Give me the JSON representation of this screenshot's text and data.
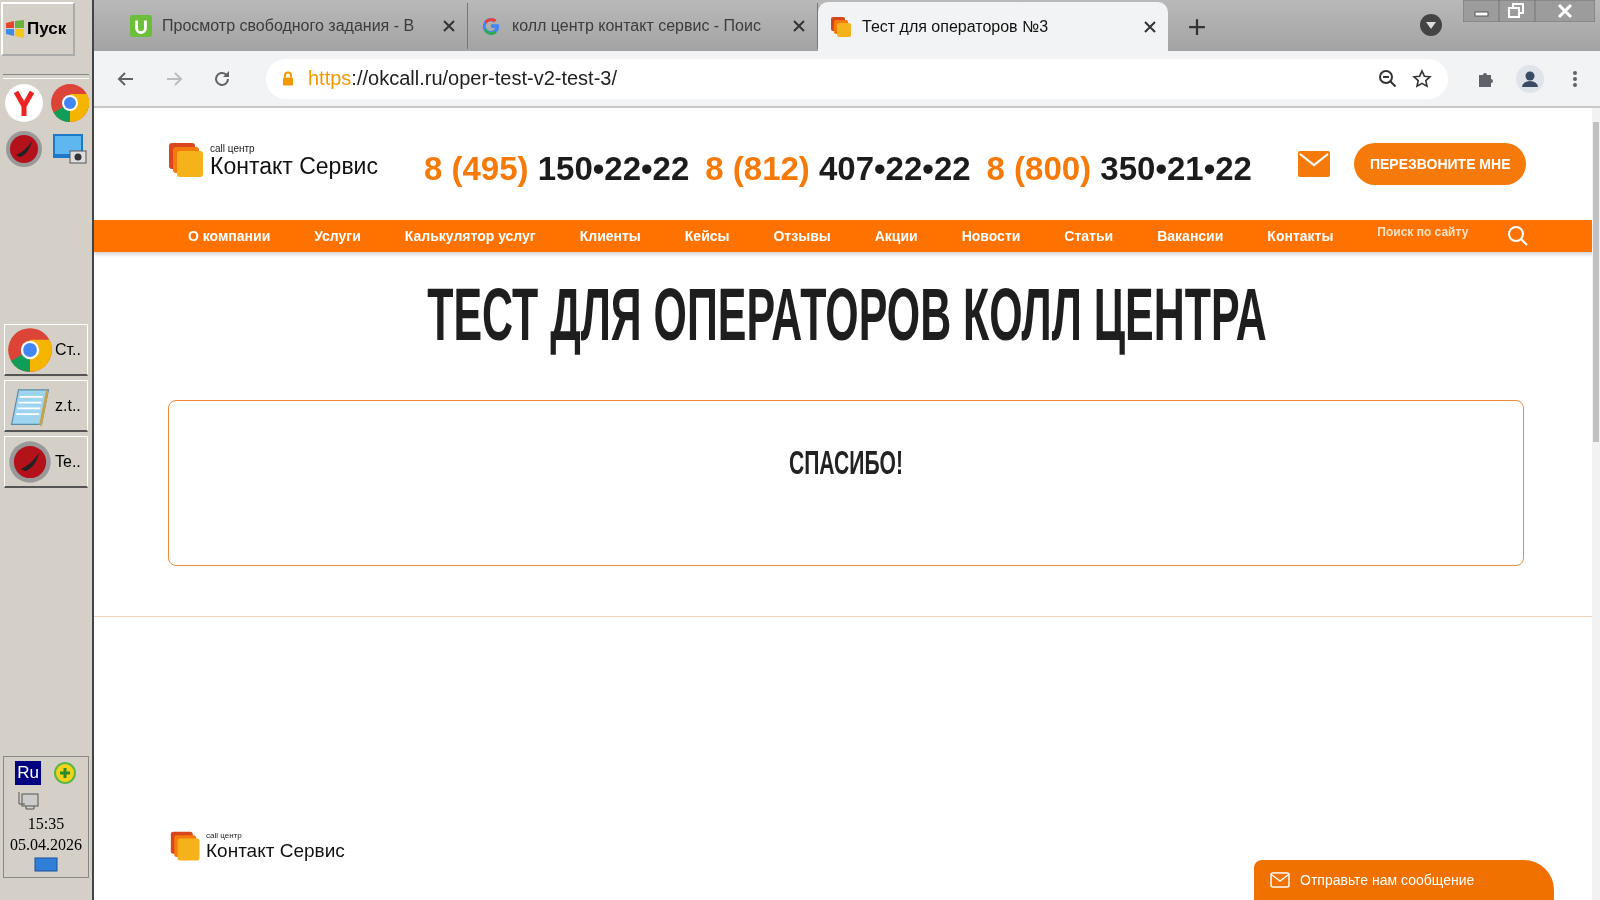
{
  "taskbar": {
    "start_button": "Пуск",
    "tasks": [
      {
        "label": "Ст..",
        "kind": "chrome"
      },
      {
        "label": "z.t..",
        "kind": "notepad"
      },
      {
        "label": "Te..",
        "kind": "comodo"
      }
    ],
    "tray": {
      "language": "Ru",
      "time": "15:35",
      "date": "05.04.2026"
    }
  },
  "browser": {
    "tabs": [
      {
        "title": "Просмотр свободного задания - В",
        "kind": "u",
        "selected": false
      },
      {
        "title": "колл центр контакт сервис - Поис",
        "kind": "google",
        "selected": false
      },
      {
        "title": "Тест для операторов №3",
        "kind": "site",
        "selected": true
      }
    ],
    "address": {
      "scheme": "https",
      "rest": "://okcall.ru/oper-test-v2-test-3/"
    }
  },
  "site": {
    "logo": {
      "tagline": "call центр",
      "name": "Контакт Сервис"
    },
    "phones": [
      {
        "code": "8 (495)",
        "number": "150•22•22"
      },
      {
        "code": "8 (812)",
        "number": "407•22•22"
      },
      {
        "code": "8 (800)",
        "number": "350•21•22"
      }
    ],
    "callback_button": "ПЕРЕЗВОНИТЕ МНЕ",
    "nav": [
      "О компании",
      "Услуги",
      "Калькулятор услуг",
      "Клиенты",
      "Кейсы",
      "Отзывы",
      "Акции",
      "Новости",
      "Статьи",
      "Вакансии",
      "Контакты"
    ],
    "search": {
      "placeholder": "Поиск по сайту"
    },
    "heading": "ТЕСТ ДЛЯ ОПЕРАТОРОВ КОЛЛ ЦЕНТРА",
    "message": "СПАСИБО!",
    "footer_logo": {
      "tagline": "call центр",
      "name": "Контакт Сервис"
    },
    "chat_button": "Отправьте нам сообщение"
  }
}
